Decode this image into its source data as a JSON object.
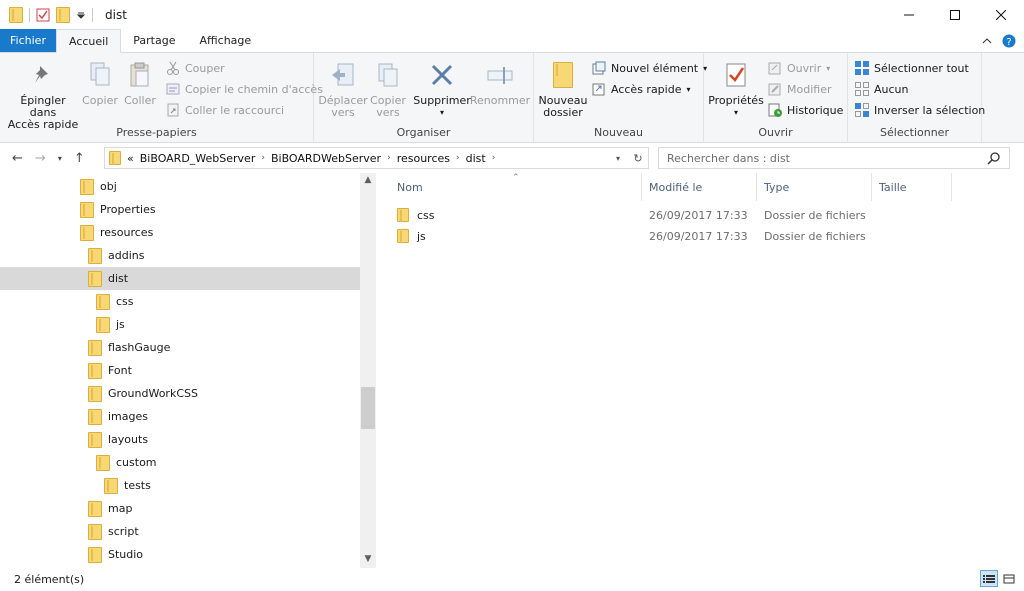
{
  "window": {
    "title": "dist"
  },
  "tabs": [
    "Fichier",
    "Accueil",
    "Partage",
    "Affichage"
  ],
  "ribbon": {
    "clipboard": {
      "label": "Presse-papiers",
      "pin": "Épingler dans Accès rapide",
      "pin_l1": "Épingler dans",
      "pin_l2": "Accès rapide",
      "copy": "Copier",
      "paste": "Coller",
      "cut": "Couper",
      "copy_path": "Copier le chemin d'accès",
      "paste_shortcut": "Coller le raccourci"
    },
    "organize": {
      "label": "Organiser",
      "move_l1": "Déplacer",
      "move_l2": "vers",
      "copyto_l1": "Copier",
      "copyto_l2": "vers",
      "delete": "Supprimer",
      "rename": "Renommer"
    },
    "new": {
      "label": "Nouveau",
      "new_folder_l1": "Nouveau",
      "new_folder_l2": "dossier",
      "new_item": "Nouvel élément",
      "easy_access": "Accès rapide"
    },
    "open": {
      "label": "Ouvrir",
      "properties": "Propriétés",
      "open": "Ouvrir",
      "edit": "Modifier",
      "history": "Historique"
    },
    "select": {
      "label": "Sélectionner",
      "select_all": "Sélectionner tout",
      "select_none": "Aucun",
      "invert": "Inverser la sélection"
    }
  },
  "address": {
    "overflow": "«",
    "crumbs": [
      "BiBOARD_WebServer",
      "BiBOARDWebServer",
      "resources",
      "dist"
    ]
  },
  "search": {
    "placeholder": "Rechercher dans : dist"
  },
  "tree": [
    {
      "label": "obj",
      "indent": 0,
      "selected": false
    },
    {
      "label": "Properties",
      "indent": 0,
      "selected": false
    },
    {
      "label": "resources",
      "indent": 0,
      "selected": false
    },
    {
      "label": "addins",
      "indent": 1,
      "selected": false
    },
    {
      "label": "dist",
      "indent": 1,
      "selected": true
    },
    {
      "label": "css",
      "indent": 2,
      "selected": false
    },
    {
      "label": "js",
      "indent": 2,
      "selected": false
    },
    {
      "label": "flashGauge",
      "indent": 1,
      "selected": false
    },
    {
      "label": "Font",
      "indent": 1,
      "selected": false
    },
    {
      "label": "GroundWorkCSS",
      "indent": 1,
      "selected": false
    },
    {
      "label": "images",
      "indent": 1,
      "selected": false
    },
    {
      "label": "layouts",
      "indent": 1,
      "selected": false
    },
    {
      "label": "custom",
      "indent": 2,
      "selected": false
    },
    {
      "label": "tests",
      "indent": 3,
      "selected": false
    },
    {
      "label": "map",
      "indent": 1,
      "selected": false
    },
    {
      "label": "script",
      "indent": 1,
      "selected": false
    },
    {
      "label": "Studio",
      "indent": 1,
      "selected": false
    }
  ],
  "columns": [
    "Nom",
    "Modifié le",
    "Type",
    "Taille"
  ],
  "files": [
    {
      "name": "css",
      "modified": "26/09/2017 17:33",
      "type": "Dossier de fichiers"
    },
    {
      "name": "js",
      "modified": "26/09/2017 17:33",
      "type": "Dossier de fichiers"
    }
  ],
  "status": {
    "count": "2 élément(s)"
  },
  "colors": {
    "accent": "#1979ca",
    "folder": "#f8d775",
    "selected": "#d9d9d9"
  }
}
